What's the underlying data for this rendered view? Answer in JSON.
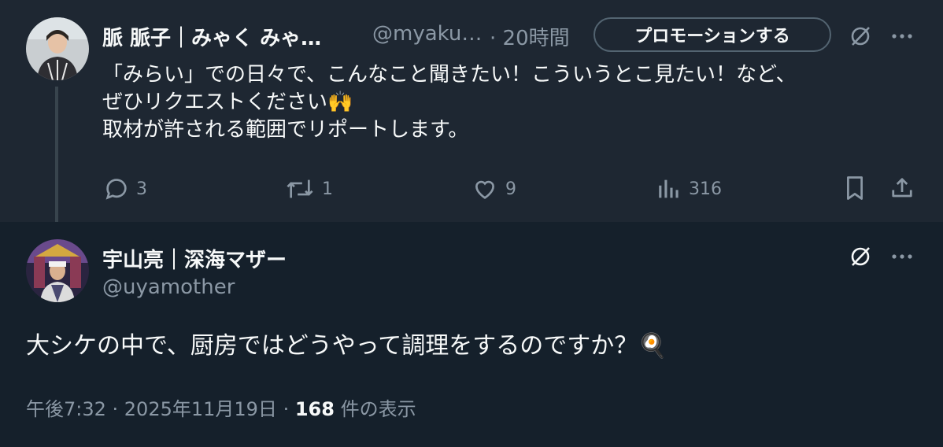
{
  "tweet1": {
    "author_name": "脈 脈子｜みゃく みゃ…",
    "handle": "@myaku…",
    "time": "· 20時間",
    "promo_label": "プロモーションする",
    "text": "「みらい」での日々で、こんなこと聞きたい！こういうとこ見たい！など、\nぜひリクエストください🙌\n取材が許される範囲でリポートします。",
    "replies": "3",
    "retweets": "1",
    "likes": "9",
    "views": "316"
  },
  "tweet2": {
    "author_name": "宇山亮｜深海マザー",
    "handle": "@uyamother",
    "text": "大シケの中で、厨房ではどうやって調理をするのですか？🍳",
    "meta_time": "午後7:32 · 2025年11月19日 · ",
    "meta_views": "168",
    "meta_views_label": " 件の表示"
  },
  "colors": {
    "background": "#15202b",
    "highlight_background": "#1e2732",
    "text_primary": "#f7f9f9",
    "text_secondary": "#8b98a5"
  },
  "icons": [
    "grok-icon",
    "more-icon",
    "reply-icon",
    "retweet-icon",
    "like-icon",
    "views-icon",
    "bookmark-icon",
    "share-icon"
  ]
}
